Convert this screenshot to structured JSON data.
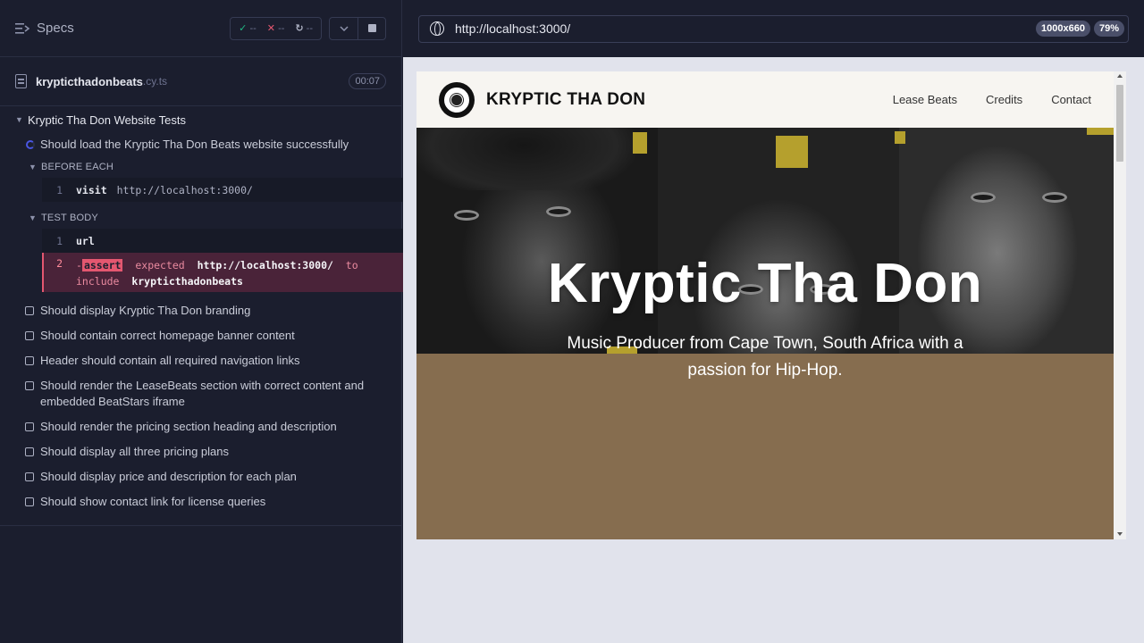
{
  "specs": {
    "title": "Specs",
    "stats": {
      "passed": "--",
      "failed": "--",
      "pending": "--"
    }
  },
  "file": {
    "name": "krypticthadonbeats",
    "ext": ".cy.ts",
    "duration": "00:07"
  },
  "suite": {
    "title": "Kryptic Tha Don Website Tests",
    "running_test": "Should load the Kryptic Tha Don Beats website successfully",
    "before_each_label": "BEFORE EACH",
    "before_cmd": {
      "num": "1",
      "name": "visit",
      "msg": "http://localhost:3000/"
    },
    "test_body_label": "TEST BODY",
    "body_cmd": {
      "num": "1",
      "name": "url"
    },
    "assert_cmd": {
      "num": "2",
      "prefix": "-",
      "badge": "assert",
      "expected": "expected",
      "url": "http://localhost:3000/",
      "to": "to",
      "include": "include",
      "value": "krypticthadonbeats"
    },
    "pending": [
      "Should display Kryptic Tha Don branding",
      "Should contain correct homepage banner content",
      "Header should contain all required navigation links",
      "Should render the LeaseBeats section with correct content and embedded BeatStars iframe",
      "Should render the pricing section heading and description",
      "Should display all three pricing plans",
      "Should display price and description for each plan",
      "Should show contact link for license queries"
    ]
  },
  "browser": {
    "url": "http://localhost:3000/",
    "viewport": "1000x660",
    "zoom": "79%"
  },
  "site": {
    "brand": "KRYPTIC THA DON",
    "nav": [
      "Lease Beats",
      "Credits",
      "Contact"
    ],
    "hero_title": "Kryptic Tha Don",
    "hero_subtitle": "Music Producer from Cape Town, South Africa with a passion for Hip-Hop.",
    "colors": {
      "hero_bg": "#866d4f",
      "accent_square": "#b5a02d"
    }
  },
  "icons": [
    "list-icon",
    "check-icon",
    "x-icon",
    "spinner-icon",
    "chevron-down-icon",
    "stop-icon",
    "file-icon",
    "globe-icon"
  ]
}
